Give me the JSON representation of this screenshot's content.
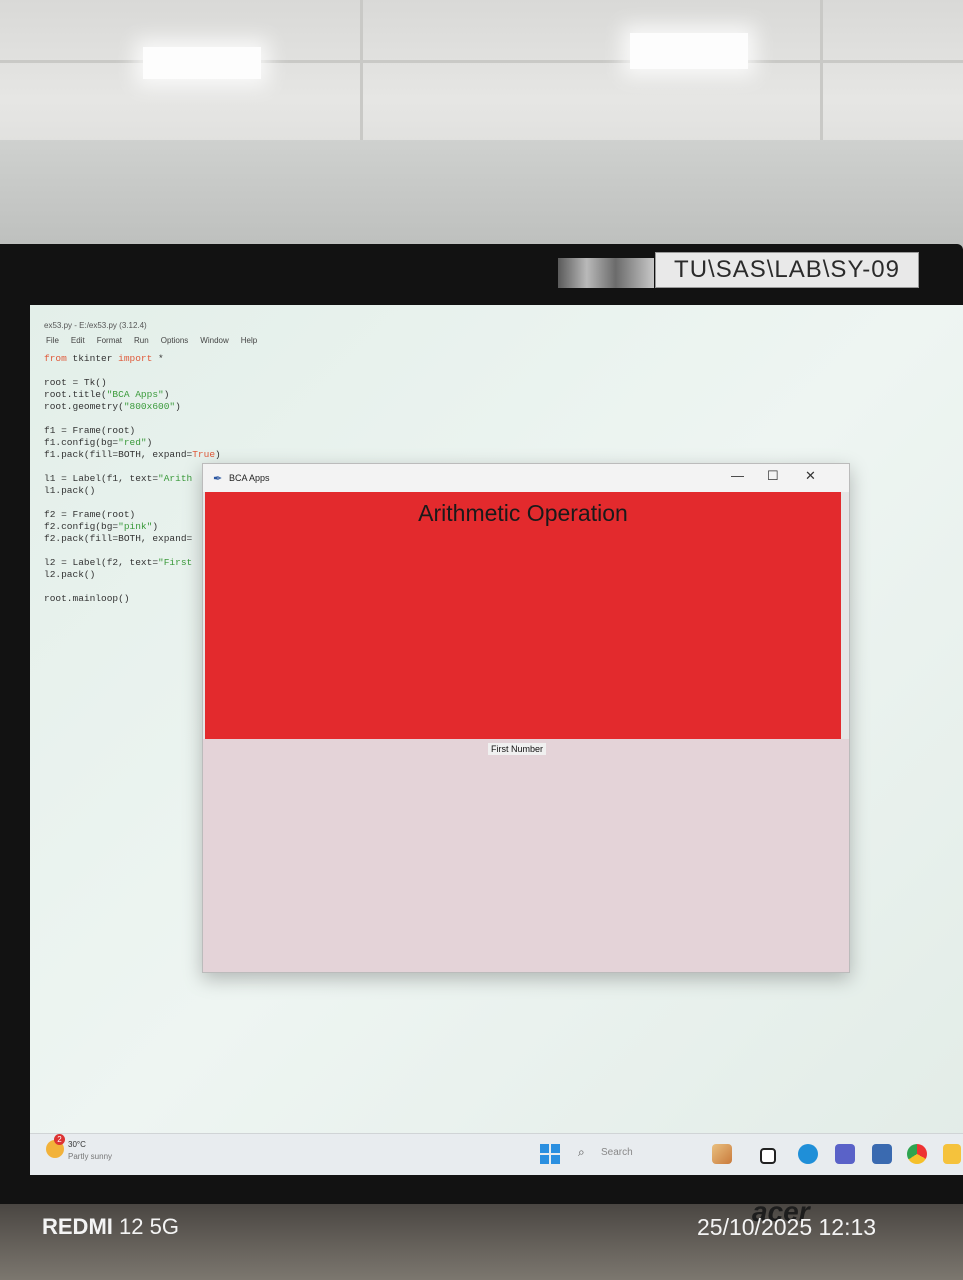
{
  "label_sticker": "TU\\SAS\\LAB\\SY-09",
  "idle": {
    "title": "ex53.py - E:/ex53.py (3.12.4)",
    "menu": [
      "File",
      "Edit",
      "Format",
      "Run",
      "Options",
      "Window",
      "Help"
    ],
    "code_lines": [
      "from tkinter import *",
      "",
      "root = Tk()",
      "root.title(\"BCA Apps\")",
      "root.geometry(\"800x600\")",
      "",
      "f1 = Frame(root)",
      "f1.config(bg=\"red\")",
      "f1.pack(fill=BOTH, expand=True)",
      "",
      "l1 = Label(f1, text=\"Arith",
      "l1.pack()",
      "",
      "f2 = Frame(root)",
      "f2.config(bg=\"pink\")",
      "f2.pack(fill=BOTH, expand=",
      "",
      "l2 = Label(f2, text=\"First",
      "l2.pack()",
      "",
      "root.mainloop()"
    ]
  },
  "tk_window": {
    "title": "BCA Apps",
    "minimize": "—",
    "maximize": "☐",
    "close": "✕",
    "heading": "Arithmetic Operation",
    "label": "First Number"
  },
  "taskbar": {
    "weather_badge": "2",
    "temperature": "30°C",
    "weather_desc": "Partly sunny",
    "search_placeholder": "Search"
  },
  "monitor_brand": "acer",
  "watermark": {
    "device_bold": "REDMI",
    "device_rest": " 12 5G",
    "datetime": "25/10/2025 12:13"
  },
  "colors": {
    "frame1_bg": "#e32a2d",
    "frame2_bg": "#e4d3d8"
  }
}
